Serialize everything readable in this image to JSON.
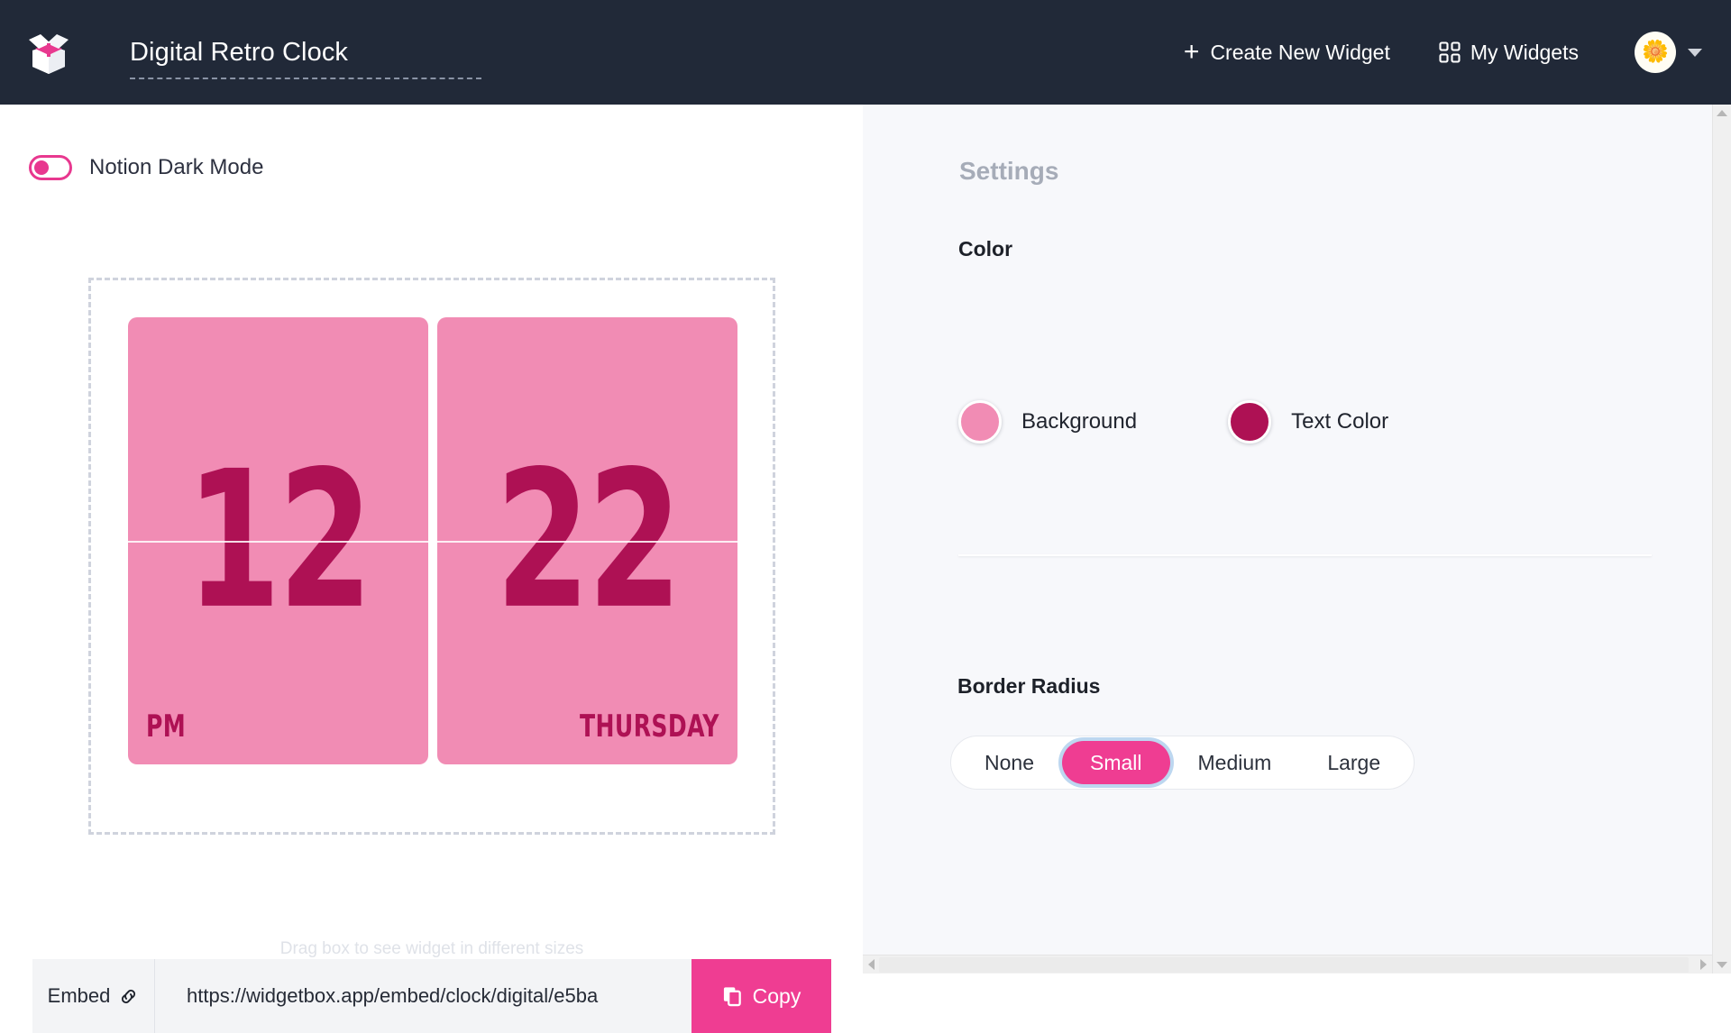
{
  "header": {
    "logo_icon": "open-box-logo-icon",
    "widget_title": "Digital Retro Clock",
    "create_widget_label": "Create New Widget",
    "create_widget_icon": "plus-icon",
    "my_widgets_label": "My Widgets",
    "my_widgets_icon": "grid-icon",
    "avatar_emoji": "🌼",
    "avatar_caret_icon": "chevron-down-icon",
    "background_color": "#212938"
  },
  "preview": {
    "dark_mode_label": "Notion Dark Mode",
    "dark_mode_on": false,
    "drag_hint": "Drag box to see widget in different sizes",
    "clock": {
      "left_value": "12",
      "left_sublabel": "PM",
      "right_value": "22",
      "right_sublabel": "THURSDAY",
      "background_color": "#F18CB4",
      "text_color": "#AE1154"
    }
  },
  "embed": {
    "label": "Embed",
    "link_icon": "link-icon",
    "url": "https://widgetbox.app/embed/clock/digital/e5ba",
    "copy_label": "Copy",
    "copy_icon": "copy-icon",
    "copy_button_color": "#ef3d92"
  },
  "settings": {
    "title": "Settings",
    "color": {
      "section_label": "Color",
      "swatches": [
        {
          "name": "Background",
          "color": "#F18CB4"
        },
        {
          "name": "Text Color",
          "color": "#AE1154"
        }
      ]
    },
    "border_radius": {
      "section_label": "Border Radius",
      "options": [
        "None",
        "Small",
        "Medium",
        "Large"
      ],
      "selected": "Small",
      "selected_color": "#ef3d92",
      "focus_ring_color": "#bdd7f0"
    }
  },
  "scrollbars": {
    "vertical_up_icon": "scroll-up-arrow-icon",
    "vertical_down_icon": "scroll-down-arrow-icon",
    "horizontal_left_icon": "scroll-left-arrow-icon",
    "horizontal_right_icon": "scroll-right-arrow-icon"
  }
}
